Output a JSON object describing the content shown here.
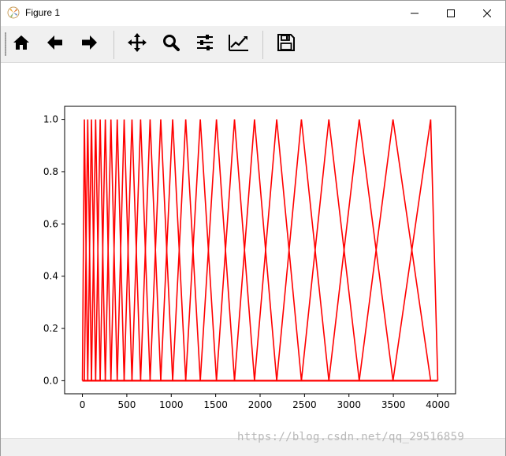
{
  "window": {
    "title": "Figure 1",
    "controls": [
      "minimize",
      "maximize",
      "close"
    ]
  },
  "toolbar": {
    "buttons": [
      {
        "name": "home-icon",
        "tooltip": "Reset original view"
      },
      {
        "name": "back-icon",
        "tooltip": "Back to previous view"
      },
      {
        "name": "forward-icon",
        "tooltip": "Forward to next view"
      },
      {
        "name": "pan-icon",
        "tooltip": "Pan axes"
      },
      {
        "name": "zoom-icon",
        "tooltip": "Zoom to rectangle"
      },
      {
        "name": "configure-subplots-icon",
        "tooltip": "Configure subplots"
      },
      {
        "name": "edit-axes-icon",
        "tooltip": "Edit axis, curve and image parameters"
      },
      {
        "name": "save-icon",
        "tooltip": "Save the figure"
      }
    ]
  },
  "watermark": "https://blog.csdn.net/qq_29516859",
  "chart_data": {
    "type": "line",
    "title": "",
    "xlabel": "",
    "ylabel": "",
    "xlim": [
      -200,
      4200
    ],
    "ylim": [
      -0.05,
      1.05
    ],
    "xticks": [
      0,
      500,
      1000,
      1500,
      2000,
      2500,
      3000,
      3500,
      4000
    ],
    "yticks": [
      0.0,
      0.2,
      0.4,
      0.6,
      0.8,
      1.0
    ],
    "xtick_labels": [
      "0",
      "500",
      "1000",
      "1500",
      "2000",
      "2500",
      "3000",
      "3500",
      "4000"
    ],
    "ytick_labels": [
      "0.0",
      "0.2",
      "0.4",
      "0.6",
      "0.8",
      "1.0"
    ],
    "grid": false,
    "line_color": "#ff0000",
    "baseline": {
      "x": [
        0,
        4000
      ],
      "y": 0
    },
    "filter_peaks_hz": [
      22,
      60,
      102,
      149,
      200,
      258,
      321,
      392,
      470,
      558,
      655,
      762,
      882,
      1016,
      1163,
      1327,
      1509,
      1712,
      1937,
      2187,
      2465,
      2774,
      3116,
      3496,
      3920
    ],
    "filter_edges_hz": [
      0,
      22,
      60,
      102,
      149,
      200,
      258,
      321,
      392,
      470,
      558,
      655,
      762,
      882,
      1016,
      1163,
      1327,
      1509,
      1712,
      1937,
      2187,
      2465,
      2774,
      3116,
      3496,
      3920,
      4000
    ]
  }
}
